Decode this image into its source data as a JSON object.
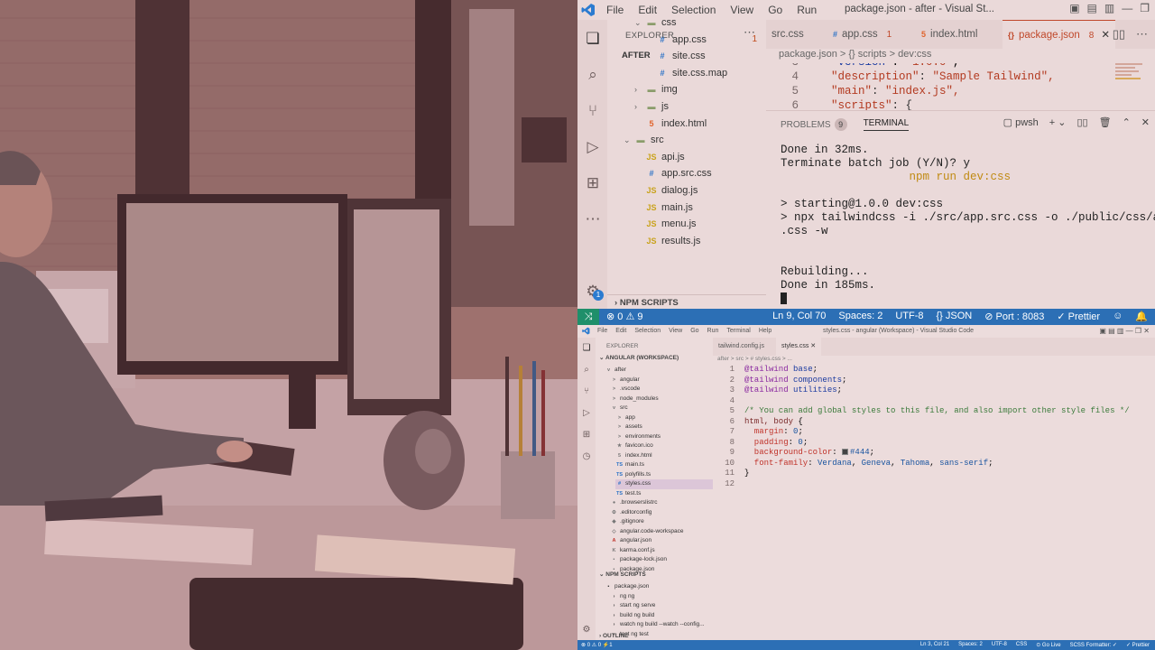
{
  "top_window": {
    "menu": [
      "File",
      "Edit",
      "Selection",
      "View",
      "Go",
      "Run"
    ],
    "title": "package.json - after - Visual St...",
    "explorer_header": "EXPLORER",
    "root_folder": "AFTER",
    "tree": [
      {
        "icon": "folder",
        "label": "css",
        "twisty": "v",
        "indent": 2,
        "err": ""
      },
      {
        "icon": "css",
        "label": "app.css",
        "indent": 3,
        "err": "1"
      },
      {
        "icon": "css",
        "label": "site.css",
        "indent": 3,
        "err": ""
      },
      {
        "icon": "css",
        "label": "site.css.map",
        "indent": 3,
        "err": ""
      },
      {
        "icon": "folder",
        "label": "img",
        "twisty": ">",
        "indent": 2,
        "err": ""
      },
      {
        "icon": "folder",
        "label": "js",
        "twisty": ">",
        "indent": 2,
        "err": ""
      },
      {
        "icon": "html",
        "label": "index.html",
        "indent": 2,
        "err": ""
      },
      {
        "icon": "folder",
        "label": "src",
        "twisty": "v",
        "indent": 1,
        "err": ""
      },
      {
        "icon": "js",
        "label": "api.js",
        "indent": 2,
        "err": ""
      },
      {
        "icon": "css",
        "label": "app.src.css",
        "indent": 2,
        "err": ""
      },
      {
        "icon": "js",
        "label": "dialog.js",
        "indent": 2,
        "err": ""
      },
      {
        "icon": "js",
        "label": "main.js",
        "indent": 2,
        "err": ""
      },
      {
        "icon": "js",
        "label": "menu.js",
        "indent": 2,
        "err": ""
      },
      {
        "icon": "js",
        "label": "results.js",
        "indent": 2,
        "err": ""
      }
    ],
    "npm_scripts_header": "NPM SCRIPTS",
    "tabs": [
      {
        "label": "src.css",
        "icon": "",
        "badge": ""
      },
      {
        "label": "app.css",
        "icon": "css",
        "badge": "1"
      },
      {
        "label": "index.html",
        "icon": "html",
        "badge": ""
      },
      {
        "label": "package.json",
        "icon": "json",
        "badge": "8",
        "active": true
      }
    ],
    "breadcrumb": "package.json > {} scripts > dev:css",
    "code": [
      {
        "ln": "4",
        "key": "\"description\"",
        "val": "\"Sample Tailwind\","
      },
      {
        "ln": "5",
        "key": "\"main\"",
        "val": "\"index.js\","
      },
      {
        "ln": "6",
        "key": "\"scripts\"",
        "val": "{"
      }
    ],
    "panel_tabs": {
      "problems": "PROBLEMS",
      "problems_count": "9",
      "terminal": "TERMINAL"
    },
    "shell": "pwsh",
    "terminal_lines": [
      "Done in 32ms.",
      "Terminate batch job (Y/N)? y",
      "                   npm run dev:css",
      "",
      "> starting@1.0.0 dev:css",
      "> npx tailwindcss -i ./src/app.src.css -o ./public/css/app",
      ".css -w",
      "",
      "",
      "Rebuilding...",
      "Done in 185ms."
    ],
    "status_left": "⊗ 0 ⚠ 9",
    "status_right": [
      "Ln 9, Col 70",
      "Spaces: 2",
      "UTF-8",
      "{} JSON",
      "⊘ Port : 8083",
      "✓ Prettier"
    ],
    "activity_badge": "1"
  },
  "bottom_window": {
    "menu": [
      "File",
      "Edit",
      "Selection",
      "View",
      "Go",
      "Run",
      "Terminal",
      "Help"
    ],
    "title": "styles.css - angular (Workspace) - Visual Studio Code",
    "explorer_header": "EXPLORER",
    "workspace": "ANGULAR (WORKSPACE)",
    "tree": [
      {
        "label": "after",
        "icon": "v",
        "indent": 1
      },
      {
        "label": "angular",
        "icon": ">",
        "indent": 2
      },
      {
        "label": ".vscode",
        "icon": ">",
        "indent": 2
      },
      {
        "label": "node_modules",
        "icon": ">",
        "indent": 2
      },
      {
        "label": "src",
        "icon": "v",
        "indent": 2
      },
      {
        "label": "app",
        "icon": ">",
        "indent": 3
      },
      {
        "label": "assets",
        "icon": ">",
        "indent": 3
      },
      {
        "label": "environments",
        "icon": ">",
        "indent": 3
      },
      {
        "label": "favicon.ico",
        "icon": "★",
        "indent": 3
      },
      {
        "label": "index.html",
        "icon": "5",
        "indent": 3
      },
      {
        "label": "main.ts",
        "icon": "TS",
        "indent": 3
      },
      {
        "label": "polyfills.ts",
        "icon": "TS",
        "indent": 3
      },
      {
        "label": "styles.css",
        "icon": "#",
        "indent": 3,
        "sel": true
      },
      {
        "label": "test.ts",
        "icon": "TS",
        "indent": 3
      },
      {
        "label": ".browserslistrc",
        "icon": "●",
        "indent": 2
      },
      {
        "label": ".editorconfig",
        "icon": "⚙",
        "indent": 2
      },
      {
        "label": ".gitignore",
        "icon": "◆",
        "indent": 2
      },
      {
        "label": "angular.code-workspace",
        "icon": "◇",
        "indent": 2
      },
      {
        "label": "angular.json",
        "icon": "A",
        "indent": 2
      },
      {
        "label": "karma.conf.js",
        "icon": "K",
        "indent": 2
      },
      {
        "label": "package-lock.json",
        "icon": "▪",
        "indent": 2
      },
      {
        "label": "package.json",
        "icon": "▪",
        "indent": 2
      }
    ],
    "npm_header": "NPM SCRIPTS",
    "npm_tree": [
      {
        "label": "package.json",
        "indent": 1
      },
      {
        "label": "ng  ng",
        "indent": 2
      },
      {
        "label": "start  ng serve",
        "indent": 2
      },
      {
        "label": "build  ng build",
        "indent": 2
      },
      {
        "label": "watch  ng build --watch --config...",
        "indent": 2
      },
      {
        "label": "test  ng test",
        "indent": 2
      }
    ],
    "outline_header": "OUTLINE",
    "tabs": [
      {
        "label": "tailwind.config.js",
        "active": false
      },
      {
        "label": "styles.css",
        "active": true
      }
    ],
    "breadcrumb": "after > src > # styles.css > ...",
    "code": [
      {
        "ln": "1",
        "parts": [
          [
            "c-at",
            "@tailwind"
          ],
          [
            "c-kw",
            " base"
          ],
          [
            "",
            "; "
          ]
        ]
      },
      {
        "ln": "2",
        "parts": [
          [
            "c-at",
            "@tailwind"
          ],
          [
            "c-kw",
            " components"
          ],
          [
            "",
            ";"
          ]
        ]
      },
      {
        "ln": "3",
        "parts": [
          [
            "c-at",
            "@tailwind"
          ],
          [
            "c-kw",
            " utilities"
          ],
          [
            "",
            ";"
          ]
        ]
      },
      {
        "ln": "4",
        "parts": []
      },
      {
        "ln": "5",
        "parts": [
          [
            "c-cm",
            "/* You can add global styles to this file, and also import other style files */"
          ]
        ]
      },
      {
        "ln": "6",
        "parts": [
          [
            "c-sel",
            "html, body"
          ],
          [
            "",
            " {"
          ]
        ]
      },
      {
        "ln": "7",
        "parts": [
          [
            "c-prop",
            "  margin"
          ],
          [
            "",
            ": "
          ],
          [
            "c-val",
            "0"
          ],
          [
            "",
            ";"
          ]
        ]
      },
      {
        "ln": "8",
        "parts": [
          [
            "c-prop",
            "  padding"
          ],
          [
            "",
            ": "
          ],
          [
            "c-val",
            "0"
          ],
          [
            "",
            ";"
          ]
        ]
      },
      {
        "ln": "9",
        "parts": [
          [
            "c-prop",
            "  background-color"
          ],
          [
            "",
            ": "
          ],
          [
            "swatch",
            ""
          ],
          [
            "c-val",
            "#444"
          ],
          [
            "",
            ";"
          ]
        ]
      },
      {
        "ln": "10",
        "parts": [
          [
            "c-prop",
            "  font-family"
          ],
          [
            "",
            ": "
          ],
          [
            "c-val",
            "Verdana"
          ],
          [
            "",
            ", "
          ],
          [
            "c-val",
            "Geneva"
          ],
          [
            "",
            ", "
          ],
          [
            "c-val",
            "Tahoma"
          ],
          [
            "",
            ", "
          ],
          [
            "c-val",
            "sans-serif"
          ],
          [
            "",
            ";"
          ]
        ]
      },
      {
        "ln": "11",
        "parts": [
          [
            "",
            "}"
          ]
        ]
      },
      {
        "ln": "12",
        "parts": []
      }
    ],
    "status_left": "⊗ 0 ⚠ 0   ⚡1",
    "status_right": [
      "Ln 3, Col 21",
      "Spaces: 2",
      "UTF-8",
      "CSS",
      "⊙ Go Live",
      "SCSS Formatter: ✓",
      "✓ Prettier"
    ]
  }
}
